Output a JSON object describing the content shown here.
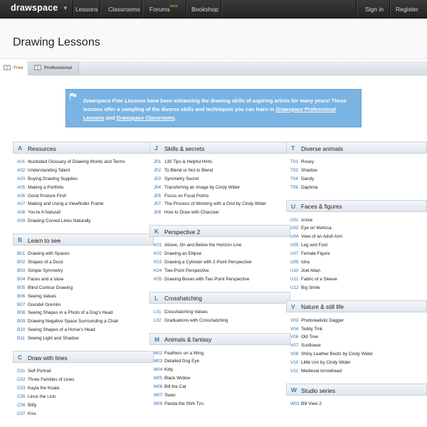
{
  "nav": {
    "logo": "drawspace",
    "items": [
      {
        "label": "Lessons"
      },
      {
        "label": "Classrooms"
      },
      {
        "label": "Forums",
        "badge": "beta"
      },
      {
        "label": "Bookshop"
      }
    ],
    "sign_in": "Sign in",
    "register": "Register"
  },
  "page_title": "Drawing Lessons",
  "tabs": [
    {
      "label": "Free",
      "active": true
    },
    {
      "label": "Professional",
      "active": false
    }
  ],
  "promo": {
    "brand": "Drawspace Free Lessons",
    "text1": " have been enhancing the drawing skills of aspiring artists for many years! These lessons offer a sampling of the diverse skills and techniques you can learn in ",
    "link1": "Drawspace Professional Lessons",
    "text2": " and ",
    "link2": "Drawspace Classrooms",
    "text3": "."
  },
  "columns": [
    [
      {
        "letter": "A",
        "title": "Resources",
        "items": [
          {
            "code": "A01",
            "text": "Illustrated Glossary of Drawing Words and Terms"
          },
          {
            "code": "A02",
            "text": "Understanding Talent"
          },
          {
            "code": "A03",
            "text": "Buying Drawing Supplies"
          },
          {
            "code": "A05",
            "text": "Making a Portfolio"
          },
          {
            "code": "A06",
            "text": "Good Posture First!"
          },
          {
            "code": "A07",
            "text": "Making and Using a Viewfinder Frame"
          },
          {
            "code": "A08",
            "text": "You're A Natural!"
          },
          {
            "code": "A09",
            "text": "Drawing Curved Lines Naturally"
          }
        ]
      },
      {
        "letter": "B",
        "title": "Learn to see",
        "items": [
          {
            "code": "B01",
            "text": "Drawing with Spaces"
          },
          {
            "code": "B02",
            "text": "Shapes of a Duck"
          },
          {
            "code": "B03",
            "text": "Simple Symmetry"
          },
          {
            "code": "B04",
            "text": "Faces and a Vase"
          },
          {
            "code": "B05",
            "text": "Blind Contour Drawing"
          },
          {
            "code": "B06",
            "text": "Seeing Values"
          },
          {
            "code": "B07",
            "text": "Grendel Gremlin"
          },
          {
            "code": "B08",
            "text": "Seeing Shapes in a Photo of a Dog's Head"
          },
          {
            "code": "B09",
            "text": "Drawing Negative Space Surrounding a Chair"
          },
          {
            "code": "B10",
            "text": "Seeing Shapes of a Horse's Head"
          },
          {
            "code": "B11",
            "text": "Seeing Light and Shadow"
          }
        ]
      },
      {
        "letter": "C",
        "title": "Draw with lines",
        "items": [
          {
            "code": "C01",
            "text": "Self Portrait"
          },
          {
            "code": "C02",
            "text": "Three Families of Lines"
          },
          {
            "code": "C03",
            "text": "Kayla the Koala"
          },
          {
            "code": "C05",
            "text": "Linus the Lion"
          },
          {
            "code": "C06",
            "text": "Bitty"
          },
          {
            "code": "C07",
            "text": "Kiss"
          }
        ]
      }
    ],
    [
      {
        "letter": "J",
        "title": "Skills & secrets",
        "items": [
          {
            "code": "J01",
            "text": "130 Tips & Helpful Hints"
          },
          {
            "code": "J02",
            "text": "To Blend or Not to Blend"
          },
          {
            "code": "J03",
            "text": "Symmetry Secret"
          },
          {
            "code": "J04",
            "text": "Transferring an Image by Cindy Wider"
          },
          {
            "code": "J05",
            "text": "Focus on Focal Points"
          },
          {
            "code": "J07",
            "text": "The Process of Working with a Grid by Cindy Wider"
          },
          {
            "code": "J08",
            "text": "How to Draw with Charcoal"
          }
        ]
      },
      {
        "letter": "K",
        "title": "Perspective 2",
        "items": [
          {
            "code": "K01",
            "text": "Above, On and Below the Horizon Line"
          },
          {
            "code": "K02",
            "text": "Drawing an Ellipse"
          },
          {
            "code": "K03",
            "text": "Drawing a Cylinder with 2-Point Perspective"
          },
          {
            "code": "K04",
            "text": "Two-Point Perspective"
          },
          {
            "code": "K05",
            "text": "Drawing Boxes with Two Point Perspective"
          }
        ]
      },
      {
        "letter": "L",
        "title": "Crosshatching",
        "items": [
          {
            "code": "L01",
            "text": "Crosshatching Values"
          },
          {
            "code": "L02",
            "text": "Graduations with Crosshatching"
          }
        ]
      },
      {
        "letter": "M",
        "title": "Animals & fantasy",
        "items": [
          {
            "code": "M02",
            "text": "Feathers on a Wing"
          },
          {
            "code": "M03",
            "text": "Detailed Dog Eye"
          },
          {
            "code": "M04",
            "text": "Kitty"
          },
          {
            "code": "M05",
            "text": "Black Widow"
          },
          {
            "code": "M06",
            "text": "Bill the Cat"
          },
          {
            "code": "M07",
            "text": "Swan"
          },
          {
            "code": "M08",
            "text": "Panda the Shih Tzu"
          }
        ]
      }
    ],
    [
      {
        "letter": "T",
        "title": "Diverse animals",
        "items": [
          {
            "code": "T01",
            "text": "Rosey"
          },
          {
            "code": "T02",
            "text": "Shadow"
          },
          {
            "code": "T04",
            "text": "Dandy"
          },
          {
            "code": "T06",
            "text": "Daphnia"
          }
        ]
      },
      {
        "letter": "U",
        "title": "Faces & figures",
        "items": [
          {
            "code": "U01",
            "text": "Annie"
          },
          {
            "code": "U02",
            "text": "Eye on Melissa"
          },
          {
            "code": "U04",
            "text": "View of an Adult Arm"
          },
          {
            "code": "U05",
            "text": "Leg and Foot"
          },
          {
            "code": "U07",
            "text": "Female Figure"
          },
          {
            "code": "U09",
            "text": "Isha"
          },
          {
            "code": "U10",
            "text": "Joel Allan"
          },
          {
            "code": "U11",
            "text": "Fabric of a Sleeve"
          },
          {
            "code": "U12",
            "text": "Big Smile"
          }
        ]
      },
      {
        "letter": "V",
        "title": "Nature & still life",
        "items": [
          {
            "code": "V03",
            "text": "Photorealistic Dagger"
          },
          {
            "code": "V04",
            "text": "Teddy Tink"
          },
          {
            "code": "V06",
            "text": "Old Tree"
          },
          {
            "code": "V07",
            "text": "Sunflower"
          },
          {
            "code": "V08",
            "text": "Shiny Leather Boots by Cindy Wider"
          },
          {
            "code": "V10",
            "text": "Little Urn by Cindy Wider"
          },
          {
            "code": "V11",
            "text": "Medieval Arrowhead"
          }
        ]
      },
      {
        "letter": "W",
        "title": "Studio series",
        "items": [
          {
            "code": "W02",
            "text": "Bill View 2"
          }
        ]
      }
    ]
  ]
}
